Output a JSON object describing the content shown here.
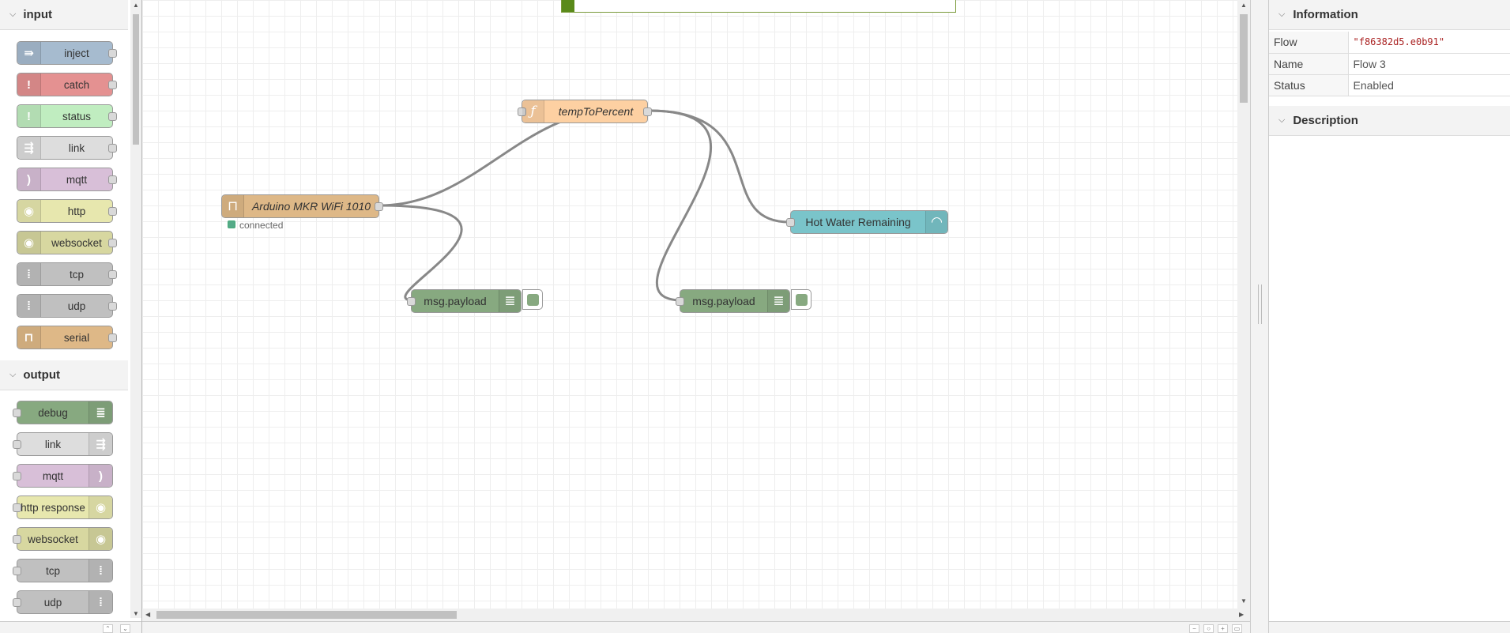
{
  "palette": {
    "input_label": "input",
    "output_label": "output",
    "input_nodes": [
      {
        "label": "inject",
        "color": "#a6bbcf",
        "icon": "arrow-in-icon",
        "glyph": "⇛"
      },
      {
        "label": "catch",
        "color": "#e49191",
        "icon": "alert-icon",
        "glyph": "!"
      },
      {
        "label": "status",
        "color": "#c0edc0",
        "icon": "alert-icon",
        "glyph": "!"
      },
      {
        "label": "link",
        "color": "#dddddd",
        "icon": "link-in-icon",
        "glyph": "⇶"
      },
      {
        "label": "mqtt",
        "color": "#d8bfd8",
        "icon": "bridge-icon",
        "glyph": ")"
      },
      {
        "label": "http",
        "color": "#e7e7ae",
        "icon": "white-globe-icon",
        "glyph": "◉"
      },
      {
        "label": "websocket",
        "color": "#d7d7a0",
        "icon": "white-globe-icon",
        "glyph": "◉"
      },
      {
        "label": "tcp",
        "color": "#c0c0c0",
        "icon": "bridge-dash-icon",
        "glyph": "⁞"
      },
      {
        "label": "udp",
        "color": "#c0c0c0",
        "icon": "bridge-dash-icon",
        "glyph": "⁞"
      },
      {
        "label": "serial",
        "color": "#deb887",
        "icon": "serial-icon",
        "glyph": "⊓"
      }
    ],
    "output_nodes": [
      {
        "label": "debug",
        "color": "#87a980",
        "icon": "debug-icon",
        "glyph": "≣"
      },
      {
        "label": "link",
        "color": "#dddddd",
        "icon": "link-out-icon",
        "glyph": "⇶"
      },
      {
        "label": "mqtt",
        "color": "#d8bfd8",
        "icon": "bridge-icon",
        "glyph": ")"
      },
      {
        "label": "http response",
        "color": "#e7e7ae",
        "icon": "white-globe-icon",
        "glyph": "◉"
      },
      {
        "label": "websocket",
        "color": "#d7d7a0",
        "icon": "white-globe-icon",
        "glyph": "◉"
      },
      {
        "label": "tcp",
        "color": "#c0c0c0",
        "icon": "bridge-dash-icon",
        "glyph": "⁞"
      },
      {
        "label": "udp",
        "color": "#c0c0c0",
        "icon": "bridge-dash-icon",
        "glyph": "⁞"
      }
    ]
  },
  "flow": {
    "nodes": {
      "arduino": {
        "label": "Arduino MKR WiFi 1010",
        "color": "#deb887",
        "status": "connected",
        "status_color": "#5a8"
      },
      "temp": {
        "label": "tempToPercent",
        "color": "#fdd0a2"
      },
      "gauge": {
        "label": "Hot Water Remaining",
        "color": "#7ac4ca"
      },
      "debug1": {
        "label": "msg.payload",
        "color": "#87a980"
      },
      "debug2": {
        "label": "msg.payload",
        "color": "#87a980"
      }
    }
  },
  "sidebar": {
    "info_header": "Information",
    "description_header": "Description",
    "rows": [
      {
        "key": "Flow",
        "value": "\"f86382d5.e0b91\""
      },
      {
        "key": "Name",
        "value": "Flow 3"
      },
      {
        "key": "Status",
        "value": "Enabled"
      }
    ]
  }
}
